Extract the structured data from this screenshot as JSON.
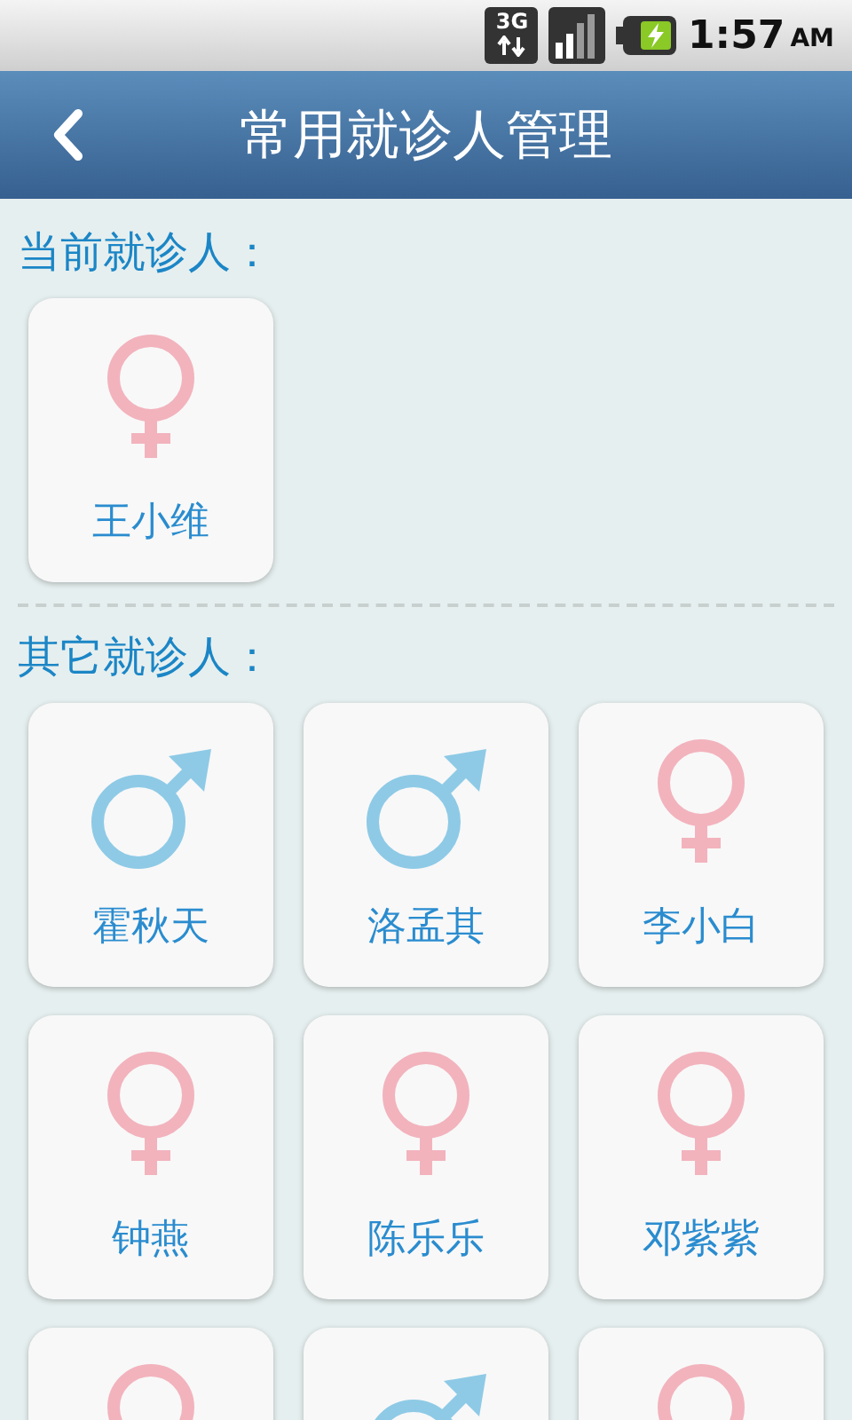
{
  "status_bar": {
    "network": "3G",
    "time": "1:57",
    "period": "AM"
  },
  "header": {
    "title": "常用就诊人管理"
  },
  "current": {
    "label": "当前就诊人：",
    "patients": [
      {
        "kind": "female",
        "name": "王小维"
      }
    ]
  },
  "others": {
    "label": "其它就诊人：",
    "patients": [
      {
        "kind": "male",
        "name": "霍秋天"
      },
      {
        "kind": "male",
        "name": "洛孟其"
      },
      {
        "kind": "female",
        "name": "李小白"
      },
      {
        "kind": "female",
        "name": "钟燕"
      },
      {
        "kind": "female",
        "name": "陈乐乐"
      },
      {
        "kind": "female",
        "name": "邓紫紫"
      },
      {
        "kind": "female"
      },
      {
        "kind": "male"
      },
      {
        "kind": "female"
      }
    ]
  }
}
